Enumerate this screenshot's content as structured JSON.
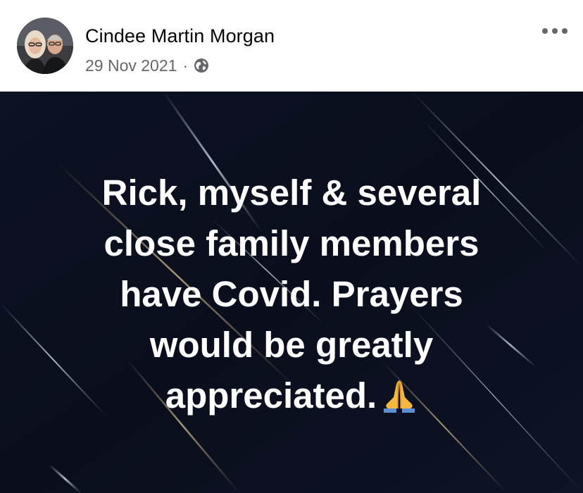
{
  "post": {
    "author": "Cindee Martin Morgan",
    "date": "29 Nov 2021",
    "separator": "·",
    "audience_icon": "globe-icon",
    "menu_icon": "more-options-icon",
    "avatar_icon": "profile-photo",
    "background": {
      "base_color": "#0c1020",
      "style": "dark night sky with diagonal light streaks"
    },
    "text_lines": [
      "Rick, myself & several",
      "close family members",
      "have Covid. Prayers",
      "would be greatly",
      "appreciated."
    ],
    "emoji": "folded-hands-icon",
    "text_color": "#ffffff"
  }
}
